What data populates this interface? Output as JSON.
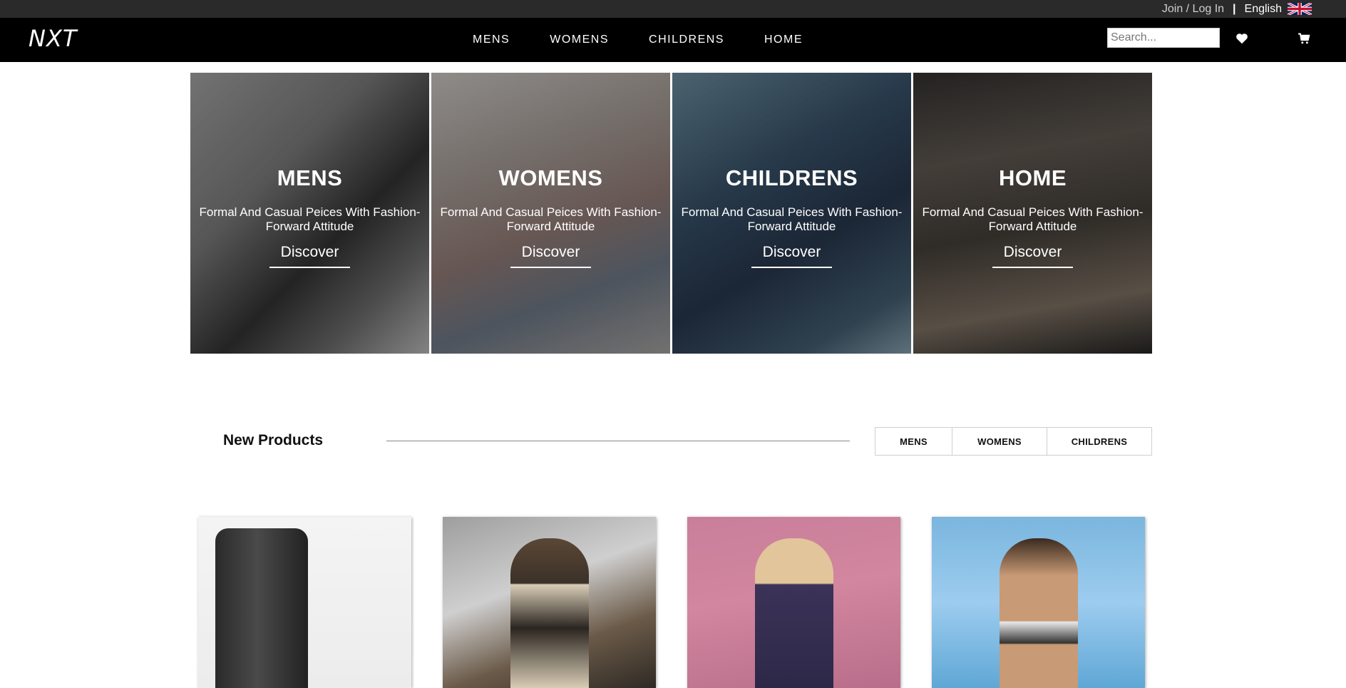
{
  "topbar": {
    "join_login": "Join / Log In",
    "separator": "|",
    "language": "English",
    "flag_icon": "uk-flag-icon"
  },
  "navbar": {
    "logo": "NXT",
    "links": [
      "MENS",
      "WOMENS",
      "CHILDRENS",
      "HOME"
    ],
    "search_placeholder": "Search...",
    "wishlist_icon": "heart-icon",
    "cart_icon": "shopping-cart-icon"
  },
  "categories": [
    {
      "title": "MENS",
      "description": "Formal And Casual Peices With Fashion-Forward Attitude",
      "button": "Discover"
    },
    {
      "title": "WOMENS",
      "description": "Formal And Casual Peices With Fashion-Forward Attitude",
      "button": "Discover"
    },
    {
      "title": "CHILDRENS",
      "description": "Formal And Casual Peices With Fashion-Forward Attitude",
      "button": "Discover"
    },
    {
      "title": "HOME",
      "description": "Formal And Casual Peices With Fashion-Forward Attitude",
      "button": "Discover"
    }
  ],
  "new_products": {
    "title": "New Products",
    "filters": [
      "MENS",
      "WOMENS",
      "CHILDRENS"
    ]
  },
  "colors": {
    "topbar": "#2a2a2a",
    "navbar": "#000000",
    "text_light": "#ffffff"
  }
}
